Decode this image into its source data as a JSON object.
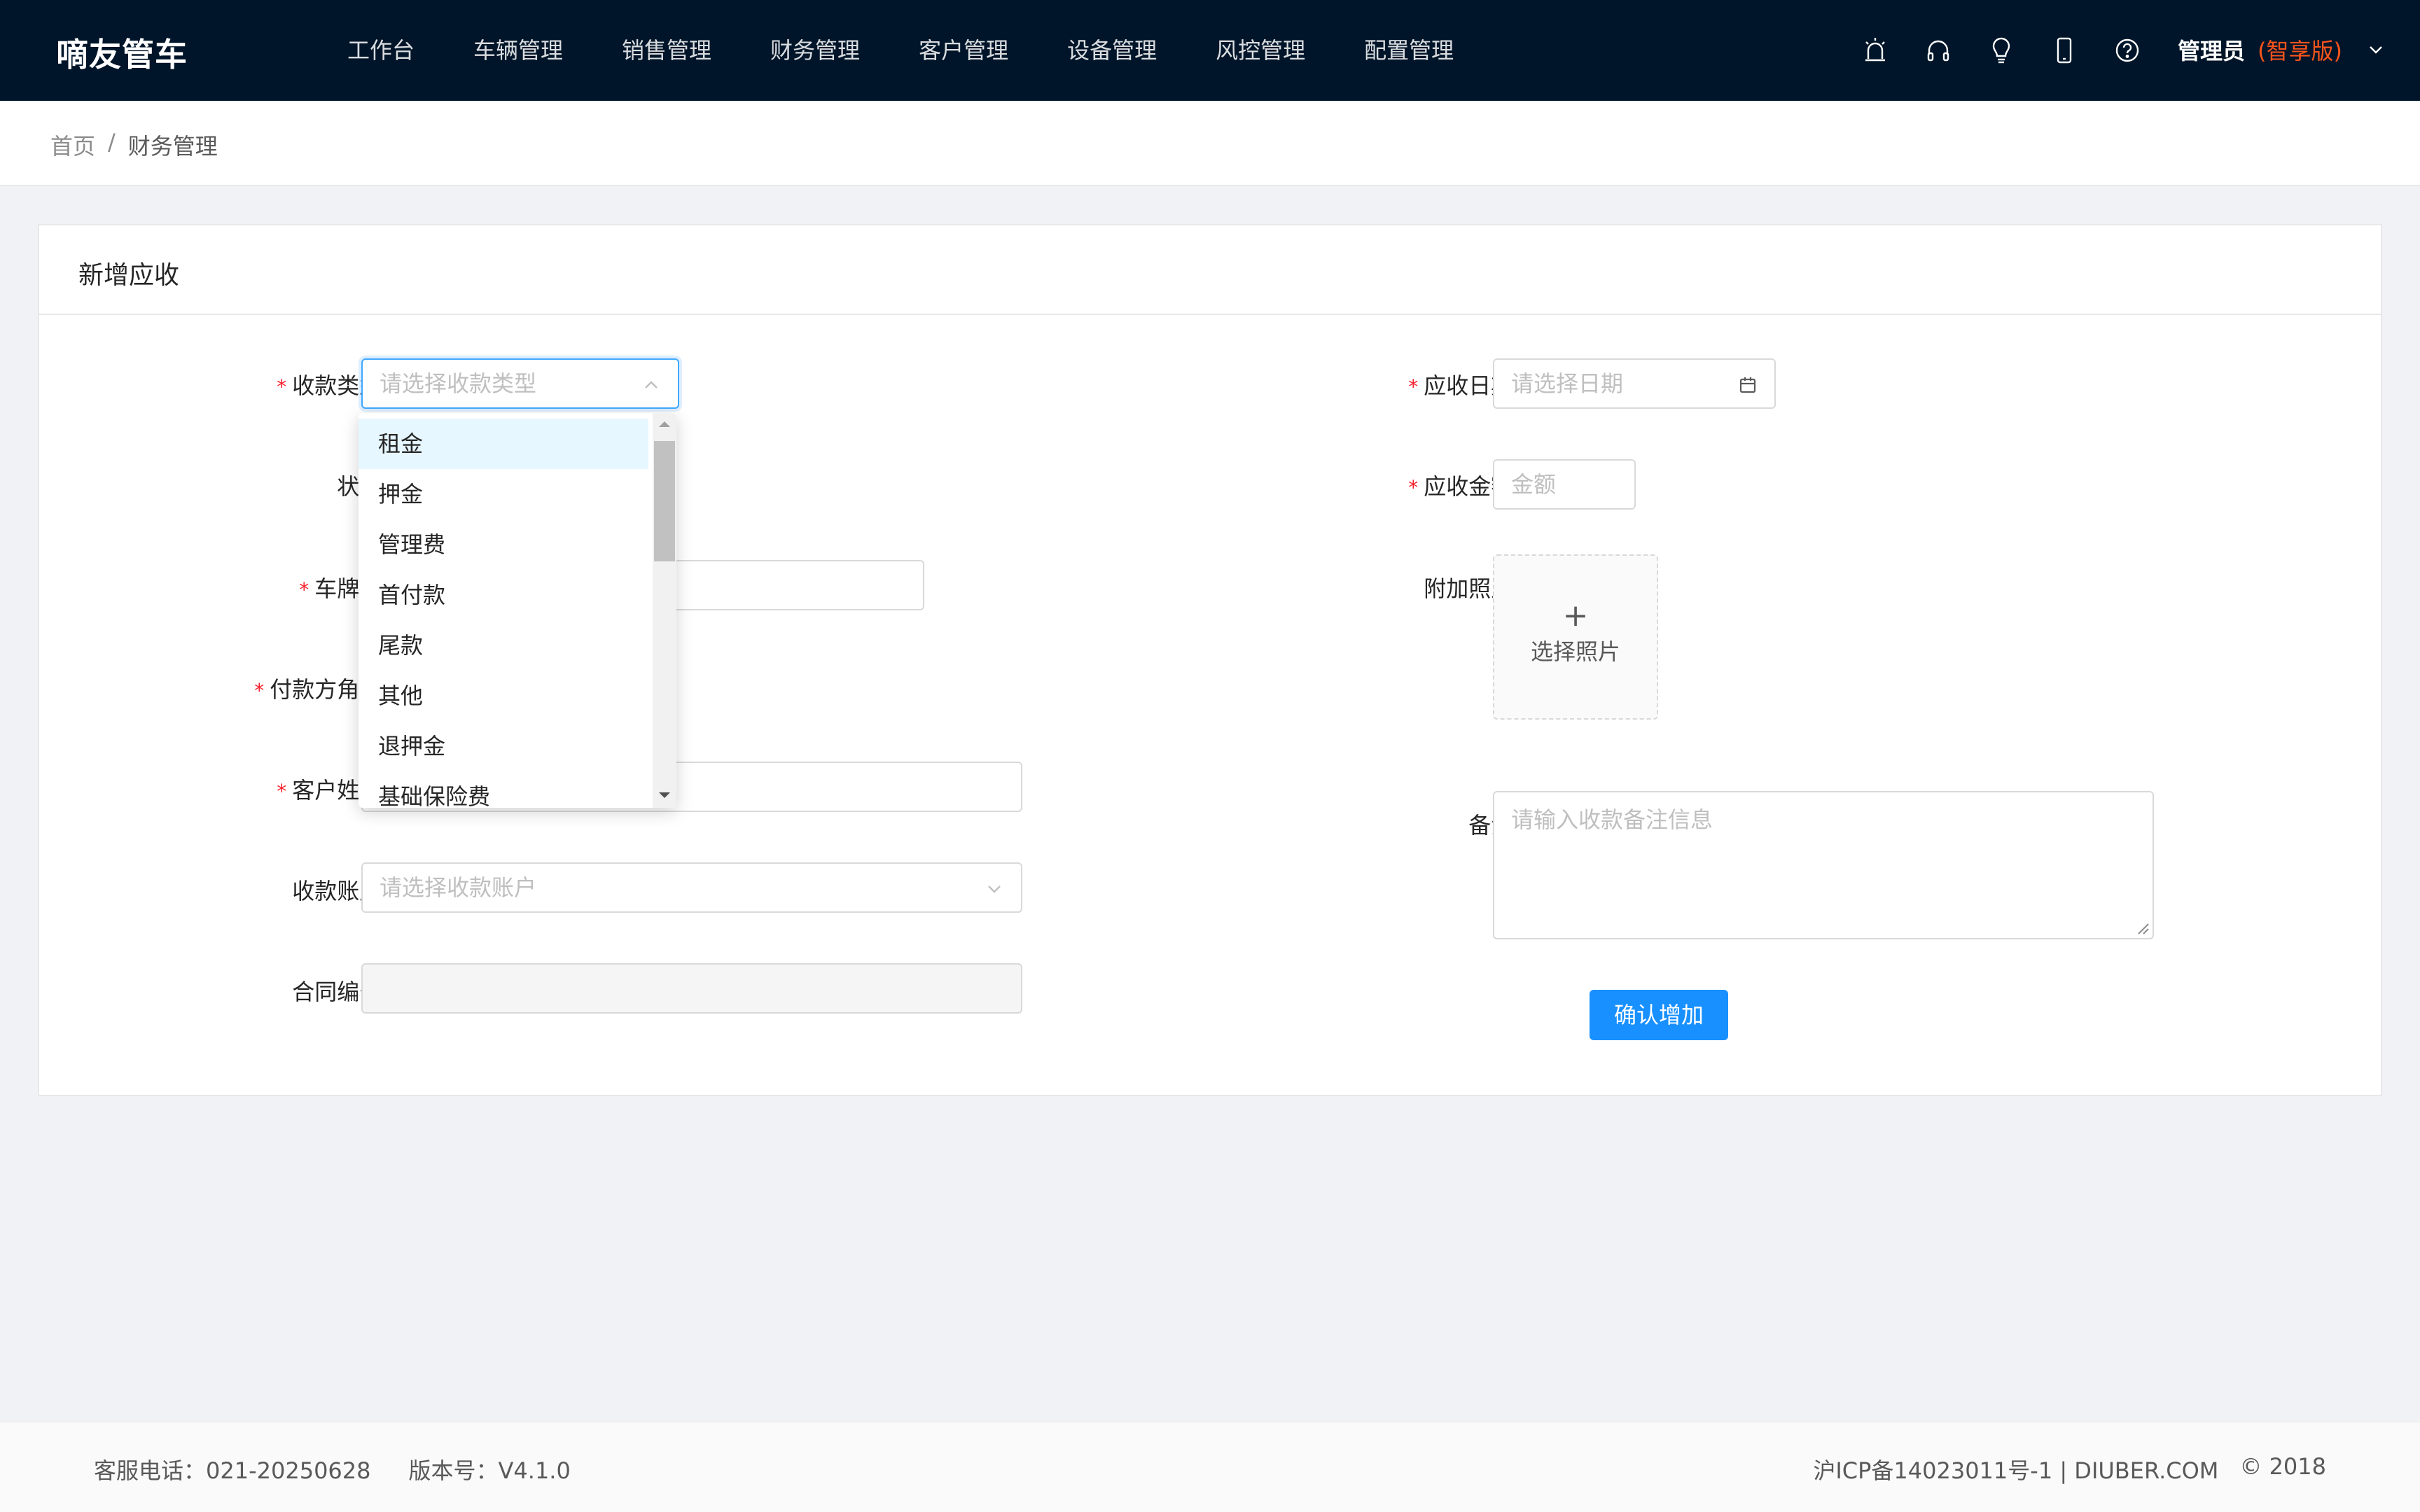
{
  "header": {
    "logo": "嘀友管车",
    "nav": [
      "工作台",
      "车辆管理",
      "销售管理",
      "财务管理",
      "客户管理",
      "设备管理",
      "风控管理",
      "配置管理"
    ],
    "icons": [
      "alarm-icon",
      "headset-icon",
      "lightbulb-icon",
      "mobile-icon",
      "help-icon"
    ],
    "user_name": "管理员",
    "user_edition": "(智享版)"
  },
  "breadcrumb": {
    "home": "首页",
    "separator": "/",
    "current": "财务管理"
  },
  "card": {
    "title": "新增应收"
  },
  "form": {
    "payment_type": {
      "label": "收款类型:",
      "placeholder": "请选择收款类型"
    },
    "status": {
      "label": "状态:"
    },
    "plate": {
      "label": "车牌号:"
    },
    "payer_role": {
      "label": "付款方角色:"
    },
    "customer_name": {
      "label": "客户姓名:"
    },
    "account": {
      "label": "收款账户:",
      "placeholder": "请选择收款账户"
    },
    "contract_no": {
      "label": "合同编号:"
    },
    "due_date": {
      "label": "应收日期:",
      "placeholder": "请选择日期"
    },
    "amount": {
      "label": "应收金额:",
      "placeholder": "金额"
    },
    "photo": {
      "label": "附加照片:",
      "plus": "+",
      "button_text": "选择照片"
    },
    "remark": {
      "label": "备注:",
      "placeholder": "请输入收款备注信息"
    },
    "submit": "确认增加",
    "required_mark": "*"
  },
  "dropdown": {
    "options": [
      "租金",
      "押金",
      "管理费",
      "首付款",
      "尾款",
      "其他",
      "退押金",
      "基础保险费"
    ],
    "highlighted_index": 0
  },
  "footer": {
    "phone": "客服电话：021-20250628",
    "version": "版本号：V4.1.0",
    "icp": "沪ICP备14023011号-1 | DIUBER.COM",
    "copyright": "© 2018"
  },
  "colors": {
    "header_bg": "#001529",
    "primary": "#1890ff",
    "required": "#f5222d",
    "edition": "#fa541c"
  }
}
